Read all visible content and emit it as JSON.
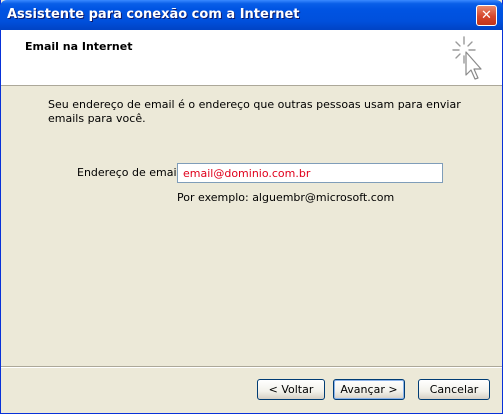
{
  "window": {
    "title": "Assistente para conexão com a Internet",
    "close_glyph": "✕"
  },
  "header": {
    "title": "Email na Internet",
    "icon": "wizard-sparkle-cursor-icon"
  },
  "body": {
    "intro": "Seu endereço de email é o endereço que outras pessoas usam para enviar emails para você.",
    "email_label": "Endereço de email:",
    "email_value": "email@dominio.com.br",
    "example": "Por exemplo: alguembr@microsoft.com"
  },
  "buttons": {
    "back": "< Voltar",
    "next": "Avançar >",
    "cancel": "Cancelar"
  },
  "colors": {
    "titlebar": "#0054e3",
    "dialog_bg": "#ece9d8",
    "input_text": "#e0001b"
  }
}
